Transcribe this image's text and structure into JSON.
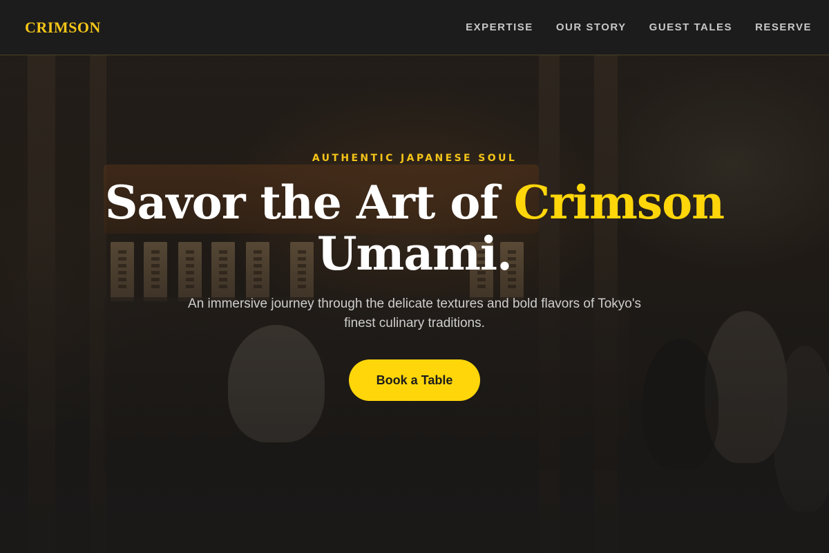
{
  "brand": {
    "name": "CRIMSON",
    "accent_color": "#f5c518",
    "cta_color": "#ffd60a"
  },
  "nav": {
    "items": [
      {
        "label": "EXPERTISE"
      },
      {
        "label": "OUR STORY"
      },
      {
        "label": "GUEST TALES"
      },
      {
        "label": "RESERVE"
      }
    ]
  },
  "hero": {
    "eyebrow": "AUTHENTIC JAPANESE SOUL",
    "headline_part1": "Savor the Art of ",
    "headline_accent": "Crimson",
    "headline_part2": "Umami.",
    "subtitle": "An immersive journey through the delicate textures and bold flavors of Tokyo's finest culinary traditions.",
    "cta_label": "Book a Table"
  }
}
